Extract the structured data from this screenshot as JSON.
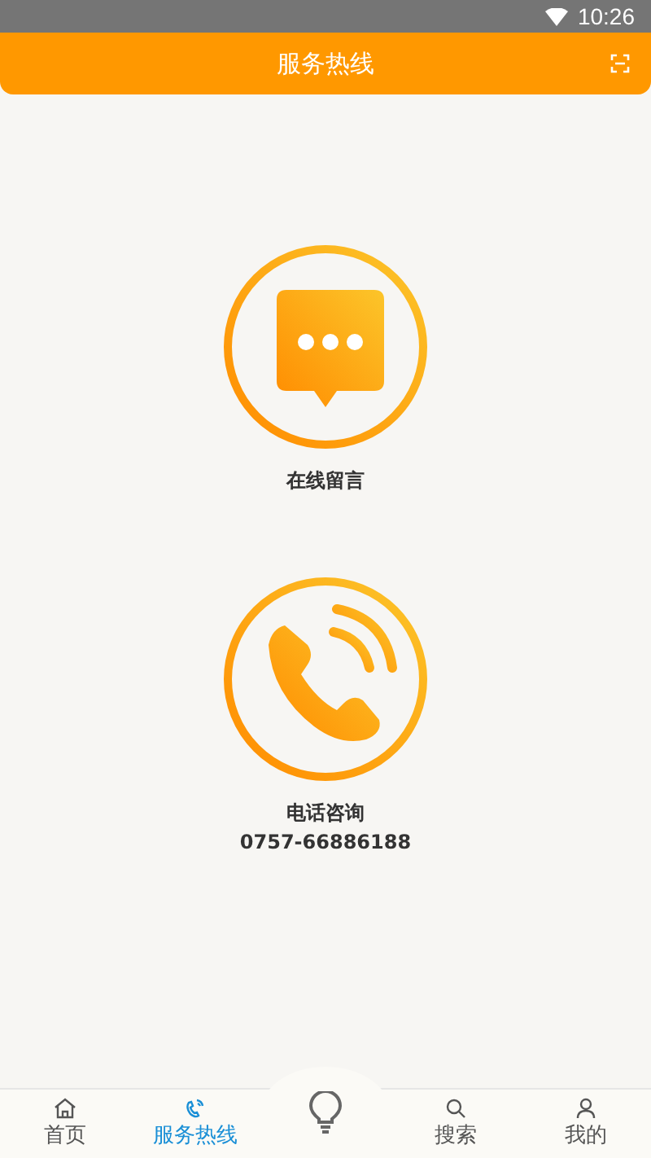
{
  "status_bar": {
    "time": "10:26"
  },
  "header": {
    "title": "服务热线"
  },
  "services": [
    {
      "kind": "message",
      "label": "在线留言"
    },
    {
      "kind": "phone",
      "label": "电话咨询",
      "phone": "0757-66886188"
    }
  ],
  "tabs": [
    {
      "kind": "home",
      "label": "首页",
      "selected": false
    },
    {
      "kind": "phone",
      "label": "服务热线",
      "selected": true
    },
    {
      "kind": "bulb",
      "selected": false
    },
    {
      "kind": "search",
      "label": "搜索",
      "selected": false
    },
    {
      "kind": "user",
      "label": "我的",
      "selected": false
    }
  ]
}
